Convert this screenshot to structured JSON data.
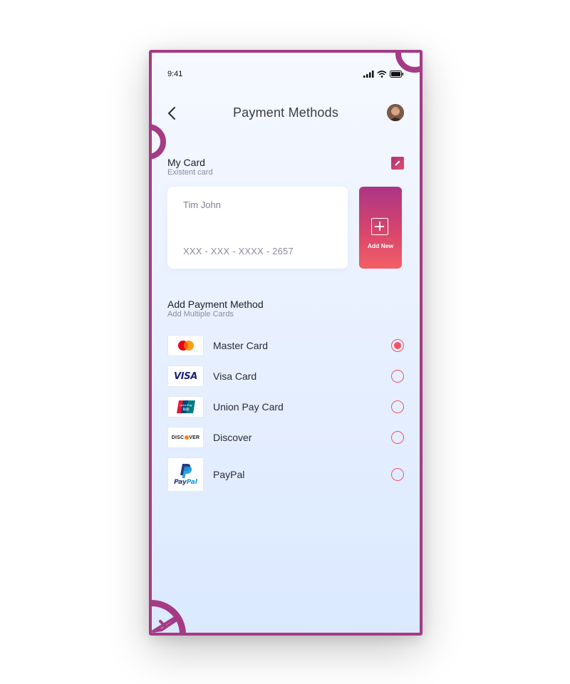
{
  "status_bar": {
    "time": "9:41"
  },
  "header": {
    "title": "Payment Methods",
    "back_icon": "chevron-left-icon",
    "avatar_icon": "user-avatar"
  },
  "my_card": {
    "title": "My Card",
    "subtitle": "Existent card",
    "edit_icon": "pencil-icon",
    "card": {
      "holder_name": "Tim John",
      "number": "XXX - XXX - XXXX - 2657"
    },
    "add_new_label": "Add New"
  },
  "add_payment": {
    "title": "Add Payment Method",
    "subtitle": "Add Multiple Cards",
    "methods": [
      {
        "label": "Master Card",
        "icon": "mastercard-logo",
        "selected": true
      },
      {
        "label": "Visa Card",
        "icon": "visa-logo",
        "selected": false
      },
      {
        "label": "Union Pay Card",
        "icon": "unionpay-logo",
        "selected": false
      },
      {
        "label": "Discover",
        "icon": "discover-logo",
        "selected": false
      },
      {
        "label": "PayPal",
        "icon": "paypal-logo",
        "selected": false
      }
    ],
    "logo_text": {
      "visa": "VISA",
      "discover_pre": "DISC",
      "discover_post": "VER",
      "paypal_a": "Pay",
      "paypal_b": "Pal",
      "unionpay": "UnionPay"
    }
  },
  "colors": {
    "accent": "#a53a86",
    "radio": "#ef5466",
    "gradient_top": "#ad3585",
    "gradient_bottom": "#f25f66"
  }
}
